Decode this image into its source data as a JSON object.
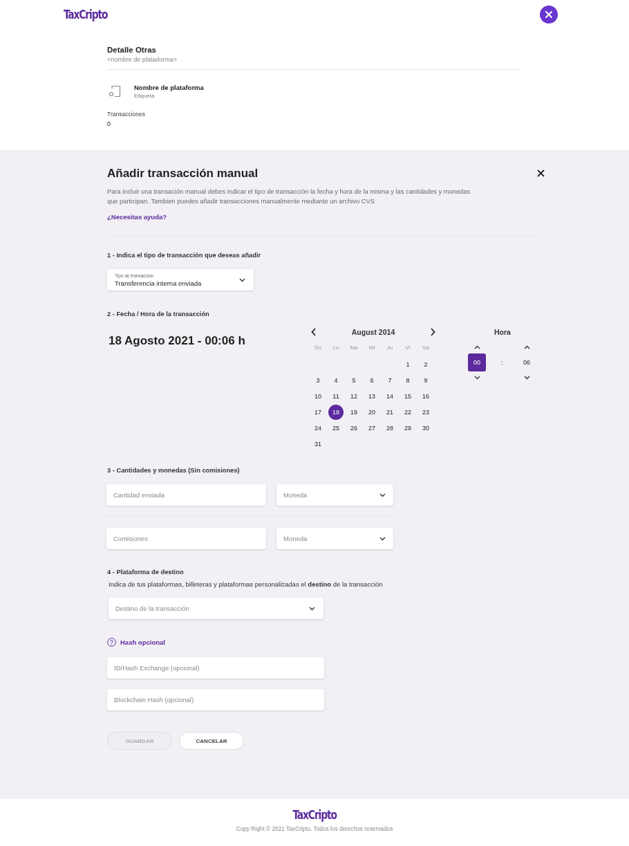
{
  "header": {
    "logo": "TaxCripto"
  },
  "detail": {
    "title": "Detalle Otras",
    "subtitle": "<nombre de platadorma>",
    "platform_name": "Nombre de plataforma",
    "platform_label": "Etiqueta",
    "transactions_label": "Transacciones",
    "transactions_value": "0"
  },
  "dialog": {
    "title": "Añadir transacción manual",
    "description": "Para incluir una transación manual debes indicar el tipo de transacción la fecha y hora de la misma y las cantidades y monedas que participan. Tambien puedes añadir transacciones manualmente mediante un archivo CVS",
    "help_link": "¿Necesitas ayuda?",
    "step1": {
      "title": "1 - Indica el tipo de transacción que deseas añadir",
      "select_label": "Tipo de transacción",
      "select_value": "Transferencia interna enviada"
    },
    "step2": {
      "title": "2 - Fecha / Hora de la transacción",
      "summary": "18 Agosto 2021 - 00:06 h",
      "calendar": {
        "month": "August 2014",
        "weekdays": [
          "Do",
          "Lu",
          "Ma",
          "Mi",
          "Ju",
          "Vi",
          "Sa"
        ],
        "weeks": [
          {
            "days": [
              {
                "day": "1",
                "selected": false
              },
              {
                "day": "2",
                "selected": false
              }
            ]
          },
          {
            "days": [
              {
                "day": "3",
                "selected": false
              },
              {
                "day": "4",
                "selected": false
              },
              {
                "day": "5",
                "selected": false
              },
              {
                "day": "6",
                "selected": false
              },
              {
                "day": "7",
                "selected": false
              },
              {
                "day": "8",
                "selected": false
              },
              {
                "day": "9",
                "selected": false
              }
            ]
          },
          {
            "days": [
              {
                "day": "10",
                "selected": false
              },
              {
                "day": "11",
                "selected": false
              },
              {
                "day": "12",
                "selected": false
              },
              {
                "day": "13",
                "selected": false
              },
              {
                "day": "14",
                "selected": false
              },
              {
                "day": "15",
                "selected": false
              },
              {
                "day": "16",
                "selected": false
              }
            ]
          },
          {
            "days": [
              {
                "day": "17",
                "selected": false
              },
              {
                "day": "18",
                "selected": true
              },
              {
                "day": "19",
                "selected": false
              },
              {
                "day": "20",
                "selected": false
              },
              {
                "day": "21",
                "selected": false
              },
              {
                "day": "22",
                "selected": false
              },
              {
                "day": "23",
                "selected": false
              }
            ]
          },
          {
            "days": [
              {
                "day": "24",
                "selected": false
              },
              {
                "day": "25",
                "selected": false
              },
              {
                "day": "26",
                "selected": false
              },
              {
                "day": "27",
                "selected": false
              },
              {
                "day": "28",
                "selected": false
              },
              {
                "day": "29",
                "selected": false
              },
              {
                "day": "30",
                "selected": false
              }
            ]
          },
          {
            "days": [
              {
                "day": "31",
                "selected": false
              }
            ]
          }
        ]
      },
      "time": {
        "title": "Hora",
        "hour": {
          "value": "00",
          "selected": true
        },
        "separator": ":",
        "minute": {
          "value": "06",
          "selected": false
        }
      }
    },
    "step3": {
      "title": "3 - Cantidades y monedas (Sin comisiones)",
      "rows": [
        {
          "amount_placeholder": "Cantidad enviada",
          "currency_placeholder": "Moneda"
        },
        {
          "amount_placeholder": "Comisiones",
          "currency_placeholder": "Moneda"
        }
      ]
    },
    "step4": {
      "title": "4 - Plataforma de destino",
      "description": "Indica de tus plataformas, billeteras y plataformas personalizadas el **destino** de la transacción",
      "select_placeholder": "Destino de la transacción"
    },
    "hash": {
      "title": "Hash opcional",
      "fields": [
        {
          "placeholder": "ID/Hash Exchange (opcional)"
        },
        {
          "placeholder": "Blockchain Hash (opcional)"
        }
      ]
    },
    "buttons": [
      {
        "label": "GUARDAR",
        "disabled": true
      },
      {
        "label": "CANCELAR",
        "disabled": false
      }
    ]
  },
  "footer": {
    "logo": "TaxCripto",
    "copyright": "Copy Right © 2021 TaxCripto. Todos los derechos reservados"
  }
}
